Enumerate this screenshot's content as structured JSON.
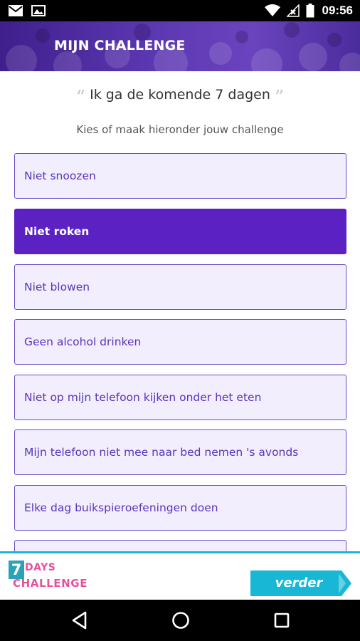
{
  "status_bar": {
    "time": "09:56",
    "icons_left": [
      "mail-icon",
      "image-icon"
    ],
    "icons_right": [
      "wifi-icon",
      "no-signal-icon",
      "battery-icon"
    ]
  },
  "header": {
    "title": "MIJN CHALLENGE"
  },
  "intro": {
    "quote": "Ik ga de komende 7 dagen",
    "open_quote": "“",
    "close_quote": "”",
    "subtitle": "Kies of maak hieronder jouw challenge"
  },
  "options": [
    {
      "label": "Niet snoozen",
      "selected": false
    },
    {
      "label": "Niet roken",
      "selected": true
    },
    {
      "label": "Niet blowen",
      "selected": false
    },
    {
      "label": "Geen alcohol drinken",
      "selected": false
    },
    {
      "label": "Niet op mijn telefoon kijken onder het eten",
      "selected": false
    },
    {
      "label": "Mijn telefoon niet mee naar bed nemen 's avonds",
      "selected": false
    },
    {
      "label": "Elke dag buikspieroefeningen doen",
      "selected": false
    },
    {
      "label": "",
      "selected": false
    }
  ],
  "footer": {
    "logo_seven": "7",
    "logo_days": "DAYS",
    "logo_challenge": "CHALLENGE",
    "next_label": "verder"
  },
  "colors": {
    "accent": "#5b21c3",
    "option_bg": "#f2eefe",
    "option_border": "#6a4cc7",
    "footer_line": "#19b7d6",
    "button": "#19b7d6",
    "logo_pink": "#ea4f9a"
  },
  "nav_bar": {
    "buttons": [
      "back-icon",
      "home-icon",
      "recents-icon"
    ]
  }
}
